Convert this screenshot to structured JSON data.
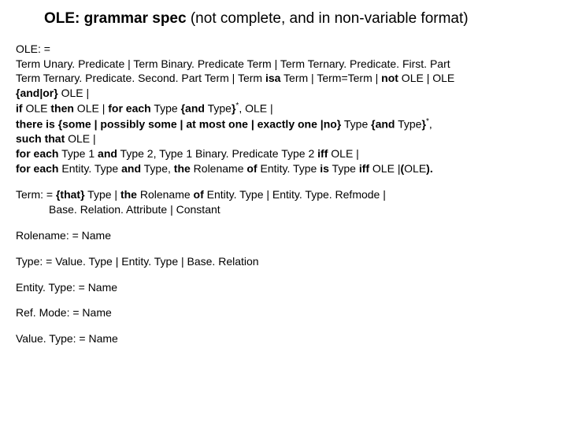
{
  "title": {
    "bold": "OLE: grammar spec",
    "rest": " (not complete, and in non-variable format)"
  },
  "ole": {
    "l1a": "OLE: =",
    "l2a": "Term Unary. Predicate | Term Binary. Predicate Term | Term Ternary. Predicate. First. Part",
    "l3a": "Term Ternary. Predicate. Second. Part Term | Term ",
    "l3b": "isa",
    "l3c": " Term | Term=Term | ",
    "l3d": "not",
    "l3e": " OLE | OLE",
    "l4a": "{and|or}",
    "l4b": " OLE |",
    "l5a": "if",
    "l5b": " OLE ",
    "l5c": "then",
    "l5d": " OLE | ",
    "l5e": "for each",
    "l5f": " Type ",
    "l5g": "{and",
    "l5h": " Type",
    "l5i": "}",
    "l5j": "*",
    "l5k": ", OLE |",
    "l6a": "there is {some | possibly some | at most one | exactly one |no}",
    "l6b": " Type ",
    "l6c": "{and",
    "l6d": " Type",
    "l6e": "}",
    "l6f": "*",
    "l6g": ",",
    "l7a": "such that",
    "l7b": " OLE |",
    "l8a": "for each",
    "l8b": " Type 1 ",
    "l8c": "and",
    "l8d": " Type 2, Type 1 Binary. Predicate Type 2 ",
    "l8e": "iff",
    "l8f": " OLE |",
    "l9a": "for each",
    "l9b": " Entity. Type ",
    "l9c": "and",
    "l9d": " Type, ",
    "l9e": "the",
    "l9f": " Rolename ",
    "l9g": "of",
    "l9h": " Entity. Type ",
    "l9i": "is",
    "l9j": " Type ",
    "l9k": "iff",
    "l9l": " OLE  |",
    "l9m": "(",
    "l9n": "OLE",
    "l9o": ").",
    "l9p": ""
  },
  "term": {
    "l1a": "Term: = ",
    "l1b": "{that}",
    "l1c": " Type | ",
    "l1d": "the",
    "l1e": " Rolename ",
    "l1f": "of",
    "l1g": " Entity. Type | Entity. Type. Refmode |",
    "l2a": "Base. Relation. Attribute | Constant"
  },
  "rolename": "Rolename: = Name",
  "type": "Type: = Value. Type | Entity. Type | Base. Relation",
  "entitytype": "Entity. Type: = Name",
  "refmode": "Ref. Mode: = Name",
  "valuetype": "Value. Type: = Name"
}
